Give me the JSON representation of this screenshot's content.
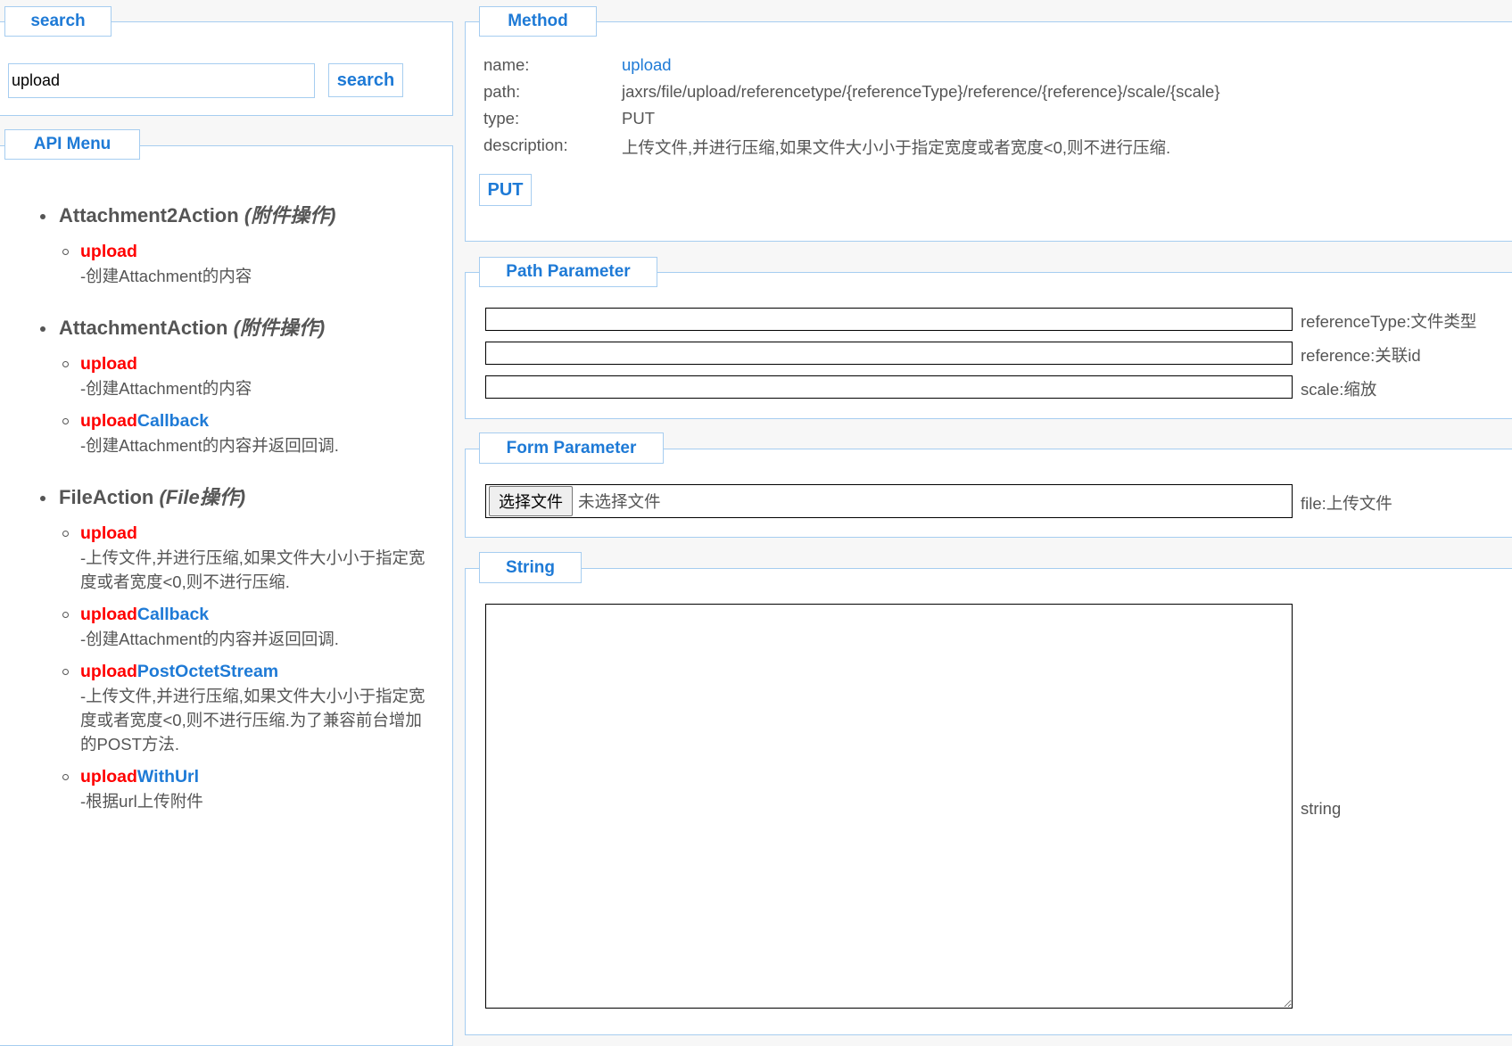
{
  "search": {
    "legend": "search",
    "input_value": "upload",
    "button": "search"
  },
  "menu": {
    "legend": "API Menu",
    "groups": [
      {
        "name": "Attachment2Action",
        "cn": "(附件操作)",
        "items": [
          {
            "match": "upload",
            "rest": "",
            "desc": "-创建Attachment的内容"
          }
        ]
      },
      {
        "name": "AttachmentAction",
        "cn": "(附件操作)",
        "items": [
          {
            "match": "upload",
            "rest": "",
            "desc": "-创建Attachment的内容"
          },
          {
            "match": "upload",
            "rest": "Callback",
            "desc": "-创建Attachment的内容并返回回调."
          }
        ]
      },
      {
        "name": "FileAction",
        "cn": "(File操作)",
        "items": [
          {
            "match": "upload",
            "rest": "",
            "desc": "-上传文件,并进行压缩,如果文件大小小于指定宽度或者宽度<0,则不进行压缩."
          },
          {
            "match": "upload",
            "rest": "Callback",
            "desc": "-创建Attachment的内容并返回回调."
          },
          {
            "match": "upload",
            "rest": "PostOctetStream",
            "desc": "-上传文件,并进行压缩,如果文件大小小于指定宽度或者宽度<0,则不进行压缩.为了兼容前台增加的POST方法."
          },
          {
            "match": "upload",
            "rest": "WithUrl",
            "desc": "-根据url上传附件"
          }
        ]
      }
    ]
  },
  "method": {
    "legend": "Method",
    "rows": [
      {
        "label": "name:",
        "value": "upload"
      },
      {
        "label": "path:",
        "value": "jaxrs/file/upload/referencetype/{referenceType}/reference/{reference}/scale/{scale}"
      },
      {
        "label": "type:",
        "value": "PUT"
      },
      {
        "label": "description:",
        "value": "上传文件,并进行压缩,如果文件大小小于指定宽度或者宽度<0,则不进行压缩."
      }
    ],
    "button": "PUT"
  },
  "path_param": {
    "legend": "Path Parameter",
    "params": [
      {
        "label": "referenceType:文件类型"
      },
      {
        "label": "reference:关联id"
      },
      {
        "label": "scale:缩放"
      }
    ]
  },
  "form_param": {
    "legend": "Form Parameter",
    "choose": "选择文件",
    "no_file": "未选择文件",
    "label": "file:上传文件"
  },
  "string": {
    "legend": "String",
    "label": "string"
  },
  "colors": {
    "accent": "#1e7ad6",
    "match": "#ff0000",
    "border": "#a6cdf0"
  }
}
